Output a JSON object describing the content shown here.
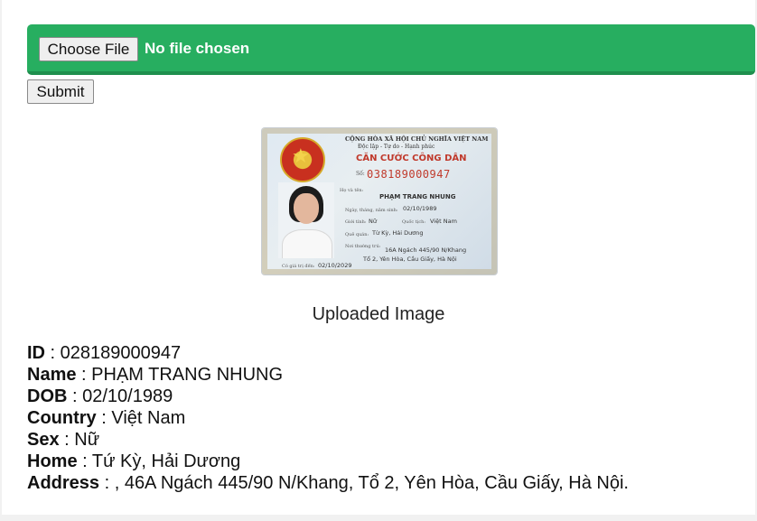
{
  "upload": {
    "choose_label": "Choose File",
    "file_status": "No file chosen",
    "bar_color": "#27ae60"
  },
  "submit_label": "Submit",
  "card": {
    "nation": "CỘNG HÒA XÃ HỘI CHỦ NGHĨA VIỆT NAM",
    "motto": "Độc lập - Tự do - Hạnh phúc",
    "title": "CĂN CƯỚC CÔNG DÂN",
    "number_label": "Số:",
    "number": "038189000947",
    "name_label": "Họ và tên:",
    "name": "PHẠM TRANG NHUNG",
    "dob_label": "Ngày, tháng, năm sinh:",
    "dob": "02/10/1989",
    "sex_label": "Giới tính:",
    "sex": "Nữ",
    "country_label": "Quốc tịch:",
    "country": "Việt Nam",
    "home_label": "Quê quán:",
    "home": "Từ Kỳ, Hải Dương",
    "address_label": "Nơi thường trú:",
    "address_line1": "16A Ngách 445/90 N/Khang",
    "address_line2": "Tổ 2, Yên Hòa, Cầu Giấy, Hà Nội",
    "expiry_label": "Có giá trị đến:",
    "expiry": "02/10/2029"
  },
  "caption": "Uploaded Image",
  "info": [
    {
      "label": "ID",
      "value": " : 028189000947"
    },
    {
      "label": "Name",
      "value": " : PHẠM TRANG NHUNG"
    },
    {
      "label": "DOB",
      "value": " : 02/10/1989"
    },
    {
      "label": "Country",
      "value": " : Việt Nam"
    },
    {
      "label": "Sex",
      "value": " : Nữ"
    },
    {
      "label": "Home",
      "value": " : Tứ Kỳ, Hải Dương"
    },
    {
      "label": "Address",
      "value": " : , 46A Ngách 445/90 N/Khang, Tổ 2, Yên Hòa, Cầu Giấy, Hà Nội."
    }
  ]
}
